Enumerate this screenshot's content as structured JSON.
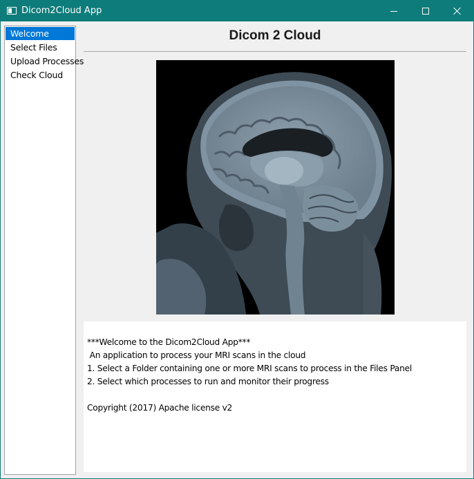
{
  "window": {
    "title": "Dicom2Cloud App"
  },
  "colors": {
    "titlebar": "#0e7c7a",
    "selection": "#0078d7"
  },
  "icons": {
    "app": "window-icon",
    "minimize": "minimize-icon",
    "maximize": "maximize-icon",
    "close": "close-icon"
  },
  "sidebar": {
    "items": [
      {
        "label": "Welcome",
        "selected": true
      },
      {
        "label": "Select Files",
        "selected": false
      },
      {
        "label": "Upload Processes",
        "selected": false
      },
      {
        "label": "Check Cloud",
        "selected": false
      }
    ]
  },
  "main": {
    "title": "Dicom 2 Cloud",
    "image": "MRI brain sagittal scan",
    "welcome": {
      "heading": "***Welcome to the Dicom2Cloud App***",
      "subtitle": " An application to process your MRI scans in the cloud",
      "step1": "1. Select a Folder containing one or more MRI scans to process in the Files Panel",
      "step2": "2. Select which processes to run and monitor their progress",
      "copyright": "Copyright (2017) Apache license v2"
    }
  }
}
